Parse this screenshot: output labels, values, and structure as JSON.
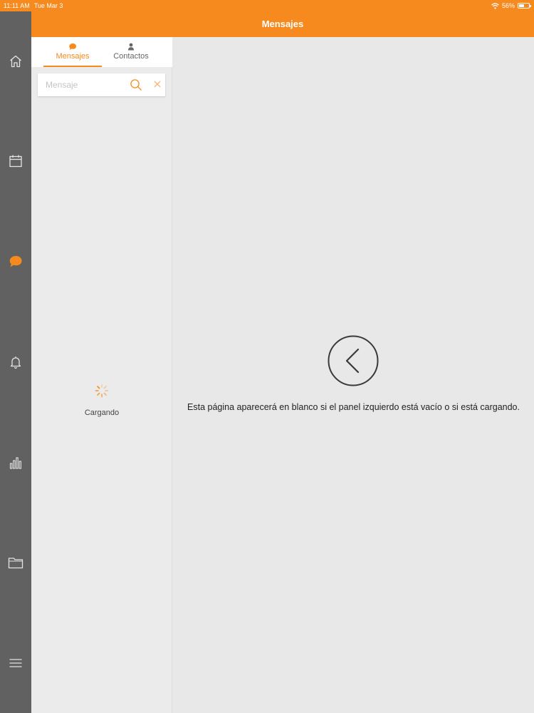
{
  "status_bar": {
    "time": "11:11 AM",
    "date": "Tue Mar 3",
    "battery": "56%",
    "battery_level": 0.56
  },
  "header": {
    "title": "Mensajes"
  },
  "rail": {
    "items": [
      {
        "icon": "home-icon"
      },
      {
        "icon": "calendar-icon"
      },
      {
        "icon": "chat-icon",
        "active": true
      },
      {
        "icon": "bell-icon"
      },
      {
        "icon": "bar-chart-icon"
      },
      {
        "icon": "folder-icon"
      },
      {
        "icon": "menu-icon"
      }
    ]
  },
  "tabs": [
    {
      "label": "Mensajes",
      "icon": "chat-icon",
      "active": true
    },
    {
      "label": "Contactos",
      "icon": "person-icon",
      "active": false
    }
  ],
  "search": {
    "placeholder": "Mensaje",
    "value": ""
  },
  "loading": {
    "label": "Cargando"
  },
  "main": {
    "message": "Esta página aparecerá en blanco si el panel izquierdo está vacío o si está cargando."
  },
  "colors": {
    "accent": "#f68a1f",
    "rail": "#616161",
    "background": "#e9e8e8"
  }
}
